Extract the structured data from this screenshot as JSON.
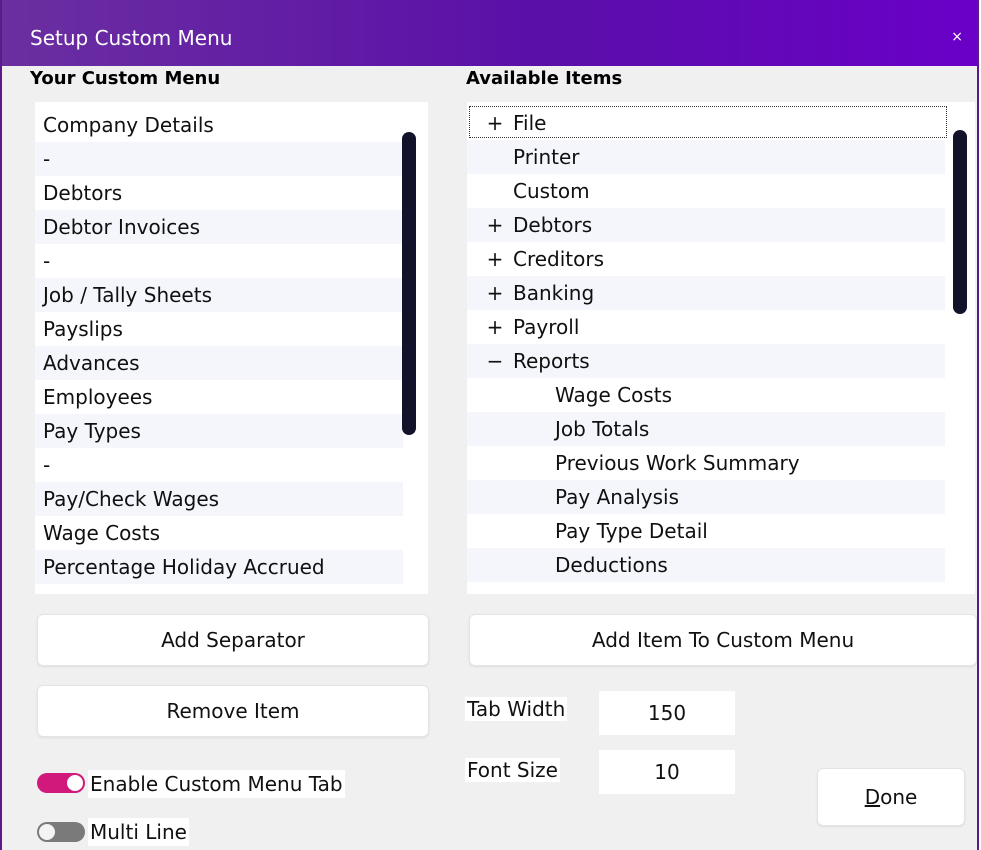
{
  "window": {
    "title": "Setup Custom Menu",
    "close_symbol": "×"
  },
  "left": {
    "heading": "Your Custom Menu",
    "items": [
      "Company Details",
      "-",
      "Debtors",
      "Debtor Invoices",
      "-",
      "Job / Tally Sheets",
      "Payslips",
      "Advances",
      "Employees",
      "Pay Types",
      "-",
      "Pay/Check Wages",
      "Wage Costs",
      "Percentage Holiday Accrued"
    ]
  },
  "right": {
    "heading": "Available Items",
    "items": [
      {
        "prefix": "+",
        "label": "File",
        "level": 0
      },
      {
        "prefix": "",
        "label": "Printer",
        "level": 0
      },
      {
        "prefix": "",
        "label": "Custom",
        "level": 0
      },
      {
        "prefix": "+",
        "label": "Debtors",
        "level": 0
      },
      {
        "prefix": "+",
        "label": "Creditors",
        "level": 0
      },
      {
        "prefix": "+",
        "label": "Banking",
        "level": 0
      },
      {
        "prefix": "+",
        "label": "Payroll",
        "level": 0
      },
      {
        "prefix": "−",
        "label": "Reports",
        "level": 0
      },
      {
        "prefix": "",
        "label": "Wage Costs",
        "level": 1
      },
      {
        "prefix": "",
        "label": "Job Totals",
        "level": 1
      },
      {
        "prefix": "",
        "label": "Previous Work Summary",
        "level": 1
      },
      {
        "prefix": "",
        "label": "Pay Analysis",
        "level": 1
      },
      {
        "prefix": "",
        "label": "Pay Type Detail",
        "level": 1
      },
      {
        "prefix": "",
        "label": "Deductions",
        "level": 1
      }
    ]
  },
  "buttons": {
    "add_separator": "Add Separator",
    "add_item": "Add Item To Custom Menu",
    "remove_item": "Remove Item",
    "done_underlined": "D",
    "done_rest": "one"
  },
  "settings": {
    "tab_width_label": "Tab Width",
    "tab_width_value": "150",
    "font_size_label": "Font Size",
    "font_size_value": "10"
  },
  "toggles": {
    "enable_custom_menu_tab": {
      "label": "Enable Custom Menu Tab",
      "on": true
    },
    "multi_line": {
      "label": "Multi Line",
      "on": false
    }
  },
  "colors": {
    "title_start": "#6b2fa0",
    "title_end": "#6a00c8",
    "toggle_on": "#d0197a",
    "scrollbar": "#12122a"
  }
}
